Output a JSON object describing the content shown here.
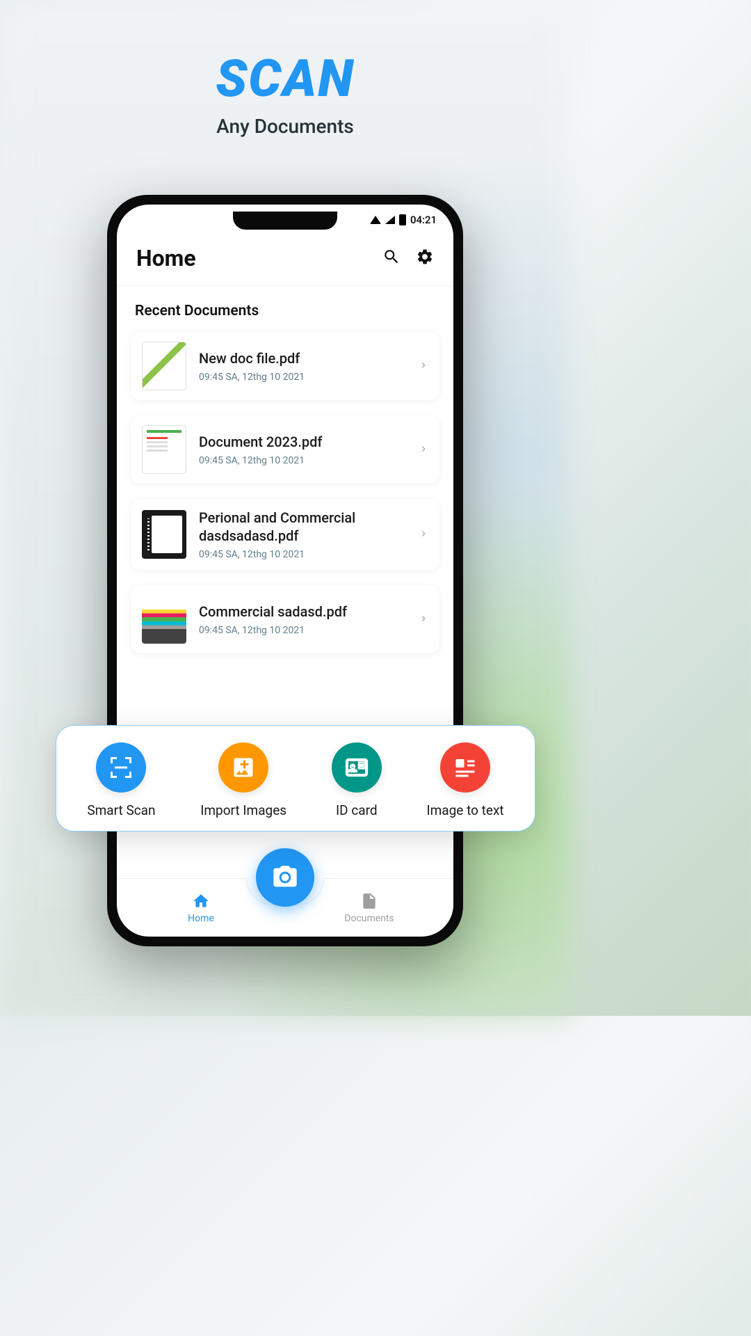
{
  "hero": {
    "title": "SCAN",
    "subtitle": "Any Documents"
  },
  "status": {
    "time": "04:21"
  },
  "header": {
    "title": "Home"
  },
  "section": {
    "title": "Recent Documents"
  },
  "documents": [
    {
      "title": "New doc file.pdf",
      "meta": "09:45 SA, 12thg 10 2021"
    },
    {
      "title": "Document 2023.pdf",
      "meta": "09:45 SA, 12thg 10 2021"
    },
    {
      "title": "Perional and Commercial dasdsadasd.pdf",
      "meta": "09:45 SA, 12thg 10 2021"
    },
    {
      "title": "Commercial sadasd.pdf",
      "meta": "09:45 SA, 12thg 10 2021"
    }
  ],
  "actions": [
    {
      "label": "Smart Scan",
      "color": "blue",
      "icon": "scan"
    },
    {
      "label": "Import Images",
      "color": "orange",
      "icon": "import"
    },
    {
      "label": "ID card",
      "color": "teal",
      "icon": "idcard"
    },
    {
      "label": "Image to text",
      "color": "red",
      "icon": "ocr"
    }
  ],
  "nav": {
    "home": "Home",
    "documents": "Documents"
  }
}
